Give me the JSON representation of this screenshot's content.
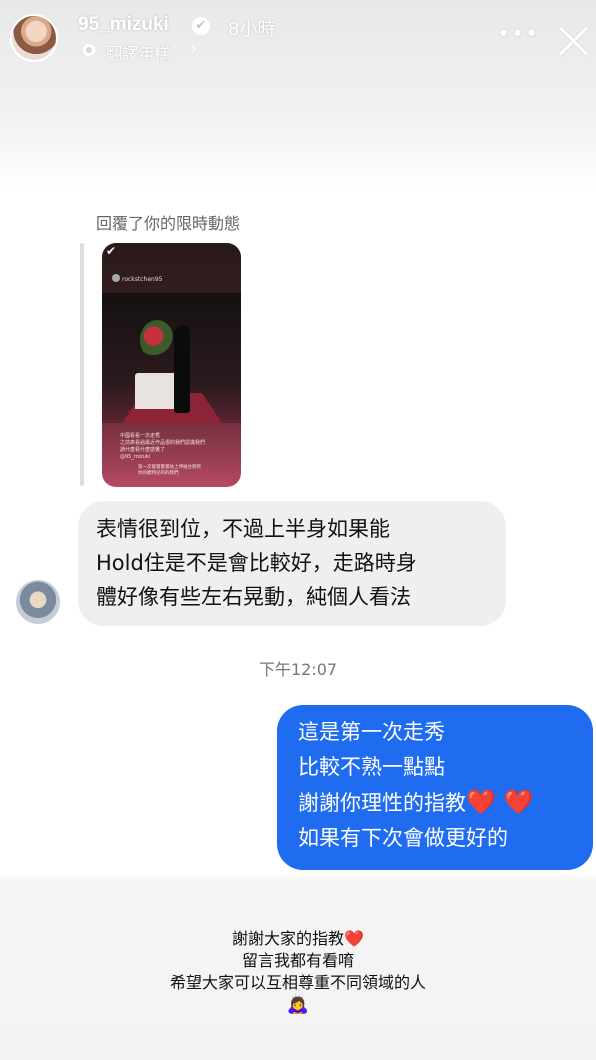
{
  "header": {
    "username": "95_mizuki",
    "time_ago": "8小時",
    "translate_label": "翻譯年糕",
    "chevron": "›",
    "more": "•••",
    "verified_mark": "✔"
  },
  "reply": {
    "label": "回覆了你的限時動態",
    "thumb_user": "rockstchen95",
    "thumb_text_1": "中國看看一次走秀",
    "thumb_text_2": "之前來看過最近作品很的我們認識我們",
    "thumb_text_3": "請什麼看什麼感覺了",
    "thumb_text_4": "@95_mizuki",
    "thumb_text_5": "第一次嘗嘗嘗嘗站上伸展台跨跨",
    "thumb_text_6": "你的模特兒的的我們"
  },
  "incoming_message": {
    "lines": [
      "表情很到位，不過上半身如果能",
      "Hold住是不是會比較好，走路時身",
      "體好像有些左右晃動，純個人看法"
    ]
  },
  "timestamp": "下午12:07",
  "outgoing_message": {
    "lines": [
      "這是第一次走秀",
      "比較不熟一點點",
      "謝謝你理性的指教",
      "如果有下次會做更好的"
    ],
    "hearts": "❤️ ❤️"
  },
  "caption": {
    "lines": [
      "謝謝大家的指教",
      "留言我都有看唷",
      "希望大家可以互相尊重不同領域的人"
    ],
    "heart": "❤️",
    "emoji": "🙇‍♀️"
  },
  "colors": {
    "outgoing_bubble": "#1f6cf0",
    "incoming_bubble": "#efefef",
    "heart": "#c8102e"
  }
}
